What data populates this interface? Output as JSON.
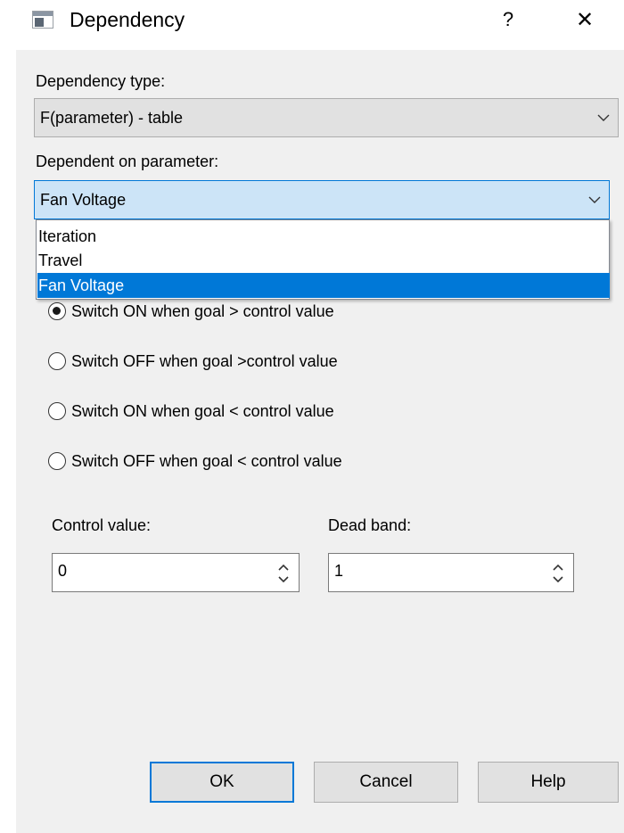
{
  "window": {
    "title": "Dependency",
    "help_glyph": "?",
    "close_glyph": "✕"
  },
  "dependency_type": {
    "label": "Dependency type:",
    "value": "F(parameter) - table"
  },
  "dependent_on": {
    "label": "Dependent on parameter:",
    "value": "Fan Voltage",
    "options": [
      "Iteration",
      "Travel",
      "Fan Voltage"
    ],
    "selected_index": 2
  },
  "switch_modes": [
    {
      "label": "Switch ON when goal > control value",
      "checked": true
    },
    {
      "label": "Switch OFF when goal >control value",
      "checked": false
    },
    {
      "label": "Switch ON when goal < control value",
      "checked": false
    },
    {
      "label": "Switch OFF when goal < control value",
      "checked": false
    }
  ],
  "control_value": {
    "label": "Control value:",
    "value": "0"
  },
  "dead_band": {
    "label": "Dead band:",
    "value": "1"
  },
  "buttons": {
    "ok": "OK",
    "cancel": "Cancel",
    "help": "Help"
  },
  "colors": {
    "accent": "#0078d7",
    "selection_bg": "#cce4f7",
    "dialog_bg": "#f0f0f0"
  },
  "icons": [
    "app-window-icon",
    "help-icon",
    "close-icon",
    "chevron-down-icon",
    "spin-up-down-icon"
  ]
}
